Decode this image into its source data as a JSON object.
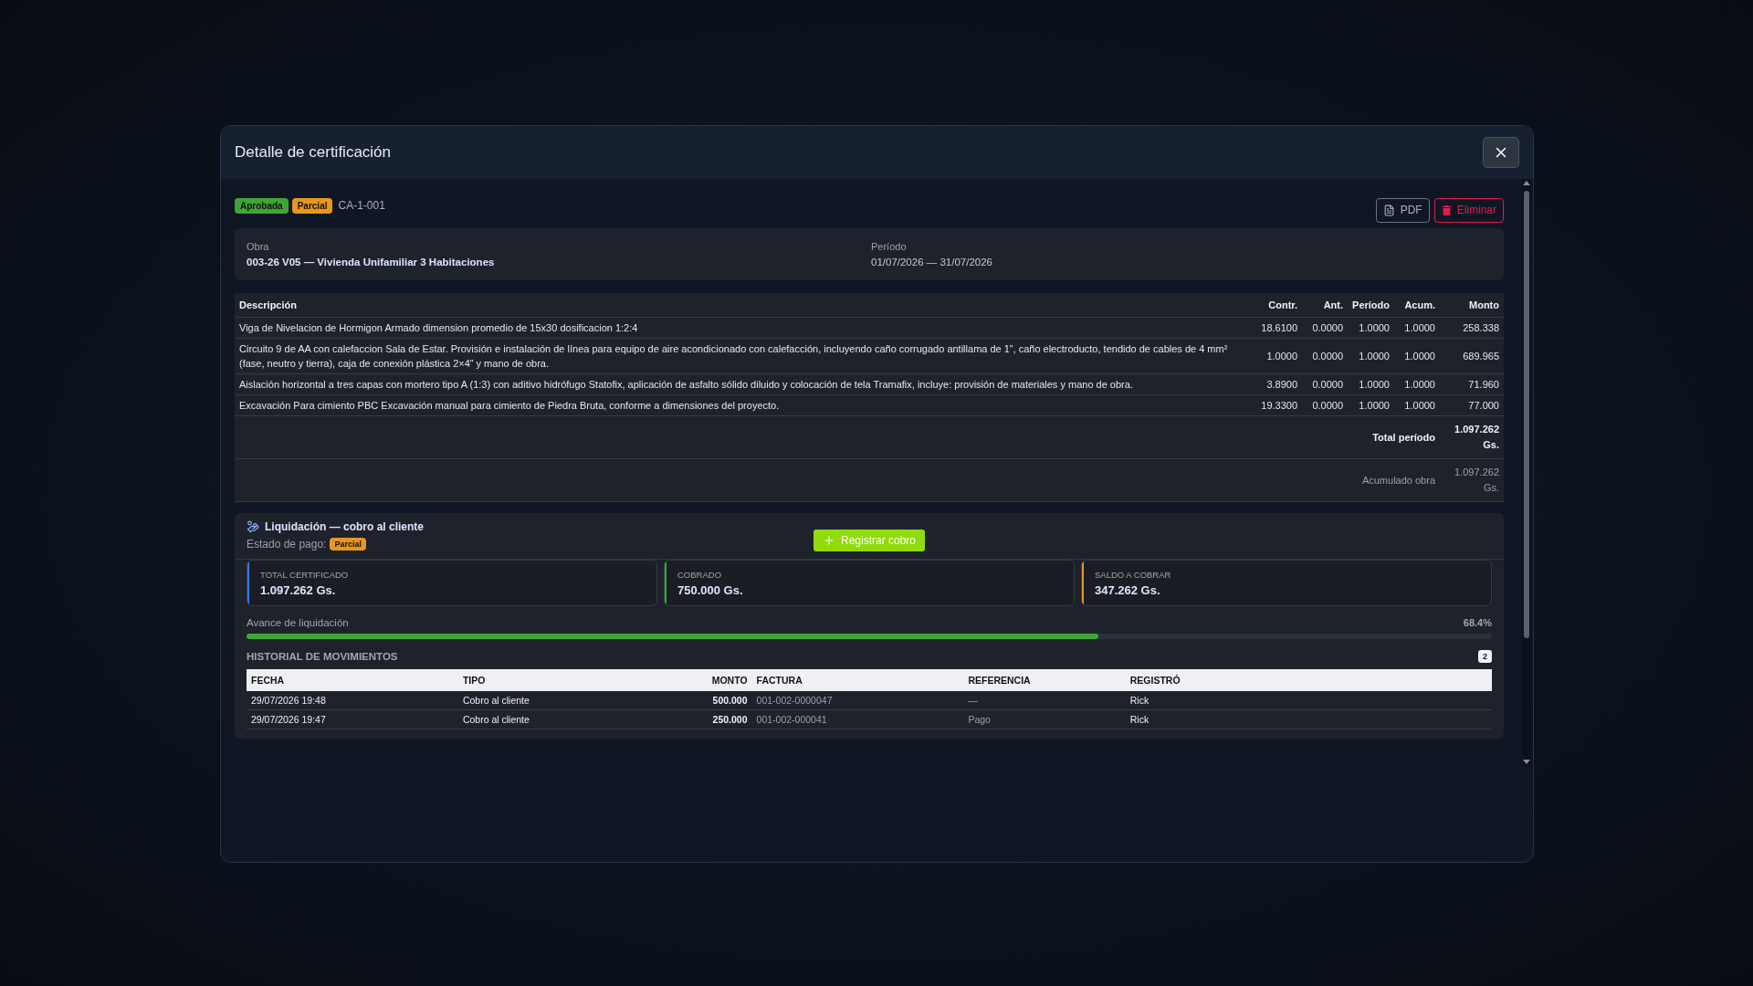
{
  "modal": {
    "title": "Detalle de certificación"
  },
  "badges": [
    {
      "label": "Aprobada",
      "color": "#3fa535"
    },
    {
      "label": "Parcial",
      "color": "#e8961c"
    }
  ],
  "code": "CA-1-001",
  "actions": [
    {
      "label": "PDF",
      "kind": "pdf"
    },
    {
      "label": "Eliminar",
      "kind": "delete"
    }
  ],
  "info": [
    {
      "label": "Obra",
      "value": "003-26 V05 — Vivienda Unifamiliar 3 Habitaciones",
      "kind": "strong"
    },
    {
      "label": "Período",
      "value": "01/07/2026 — 31/07/2026",
      "kind": "plain"
    }
  ],
  "items": {
    "columns": [
      "Descripción",
      "Contr.",
      "Ant.",
      "Período",
      "Acum.",
      "Monto"
    ],
    "rows": [
      [
        "Viga de Nivelacion de Hormigon Armado dimension promedio de 15x30 dosificacion 1:2:4",
        "18.6100",
        "0.0000",
        "1.0000",
        "1.0000",
        "258.338"
      ],
      [
        "Circuito 9 de AA con calefaccion Sala de Estar. Provisión e instalación de línea para equipo de aire acondicionado con calefacción, incluyendo caño corrugado antillama de 1”, caño electroducto, tendido de cables de 4 mm² (fase, neutro y tierra), caja de conexión plástica 2×4” y mano de obra.",
        "1.0000",
        "0.0000",
        "1.0000",
        "1.0000",
        "689.965"
      ],
      [
        "Aislación horizontal a tres capas con mortero tipo A (1:3) con aditivo hidrófugo Statofix, aplicación de asfalto sólido diluido y colocación de tela Tramafix, incluye: provisión de materiales y mano de obra.",
        "3.8900",
        "0.0000",
        "1.0000",
        "1.0000",
        "71.960"
      ],
      [
        "Excavación Para cimiento PBC Excavación manual para cimiento de Piedra Bruta, conforme a dimensiones del proyecto.",
        "19.3300",
        "0.0000",
        "1.0000",
        "1.0000",
        "77.000"
      ]
    ],
    "totals": [
      {
        "label": "Total período",
        "value": "1.097.262 Gs.",
        "kind": "strong"
      },
      {
        "label": "Acumulado obra",
        "value": "1.097.262 Gs.",
        "kind": "muted"
      }
    ]
  },
  "liquidacion": {
    "title": "Liquidación — cobro al cliente",
    "estado_label": "Estado de pago:",
    "estado": {
      "label": "Parcial",
      "color": "#e8961c"
    },
    "button": "Registrar cobro",
    "summary": [
      {
        "label": "TOTAL CERTIFICADO",
        "value": "1.097.262 Gs.",
        "color": "#2f7bf5"
      },
      {
        "label": "COBRADO",
        "value": "750.000 Gs.",
        "color": "#3fa535"
      },
      {
        "label": "SALDO A COBRAR",
        "value": "347.262 Gs.",
        "color": "#e8961c"
      }
    ],
    "progress": {
      "label": "Avance de liquidación",
      "reading": "68.4%",
      "level": 0.684
    },
    "history": {
      "title": "HISTORIAL DE MOVIMIENTOS",
      "count": "2",
      "columns": [
        {
          "label": "FECHA",
          "kind": "text"
        },
        {
          "label": "TIPO",
          "kind": "text"
        },
        {
          "label": "MONTO",
          "kind": "amount"
        },
        {
          "label": "FACTURA",
          "kind": "muted"
        },
        {
          "label": "REFERENCIA",
          "kind": "muted"
        },
        {
          "label": "REGISTRÓ",
          "kind": "text"
        }
      ],
      "rows": [
        [
          "29/07/2026 19:48",
          "Cobro al cliente",
          "500.000",
          "001-002-0000047",
          "—",
          "Rick"
        ],
        [
          "29/07/2026 19:47",
          "Cobro al cliente",
          "250.000",
          "001-002-000041",
          "Pago",
          "Rick"
        ]
      ]
    }
  }
}
